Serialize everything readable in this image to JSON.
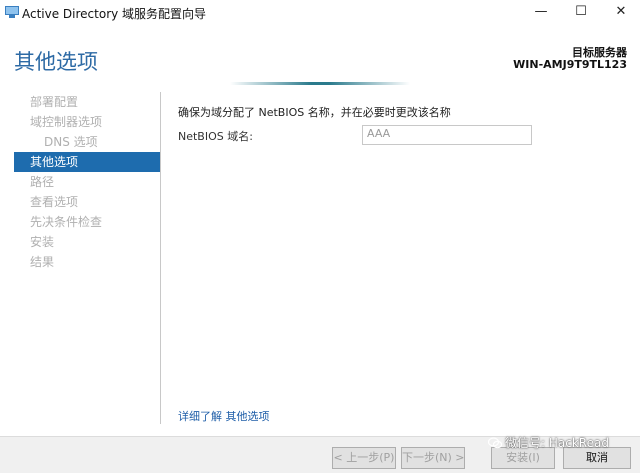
{
  "window": {
    "title": "Active Directory 域服务配置向导",
    "minimize": "—",
    "maximize": "☐",
    "close": "✕"
  },
  "header": {
    "page_title": "其他选项",
    "target_server_label": "目标服务器",
    "target_server_name": "WIN-AMJ9T9TL123"
  },
  "nav": {
    "items": [
      {
        "label": "部署配置",
        "active": false,
        "sub": false
      },
      {
        "label": "域控制器选项",
        "active": false,
        "sub": false
      },
      {
        "label": "DNS 选项",
        "active": false,
        "sub": true
      },
      {
        "label": "其他选项",
        "active": true,
        "sub": false
      },
      {
        "label": "路径",
        "active": false,
        "sub": false
      },
      {
        "label": "查看选项",
        "active": false,
        "sub": false
      },
      {
        "label": "先决条件检查",
        "active": false,
        "sub": false
      },
      {
        "label": "安装",
        "active": false,
        "sub": false
      },
      {
        "label": "结果",
        "active": false,
        "sub": false
      }
    ]
  },
  "main": {
    "description": "确保为域分配了 NetBIOS 名称，并在必要时更改该名称",
    "netbios_label": "NetBIOS 域名:",
    "netbios_value": "AAA",
    "more_link": "详细了解 其他选项"
  },
  "footer": {
    "prev": "< 上一步(P)",
    "next": "下一步(N) >",
    "install": "安装(I)",
    "cancel": "取消"
  },
  "watermark": {
    "text": "微信号: HackRead"
  },
  "colors": {
    "accent": "#1e6cae",
    "title": "#2d6aa5",
    "link": "#1f5ea8"
  }
}
